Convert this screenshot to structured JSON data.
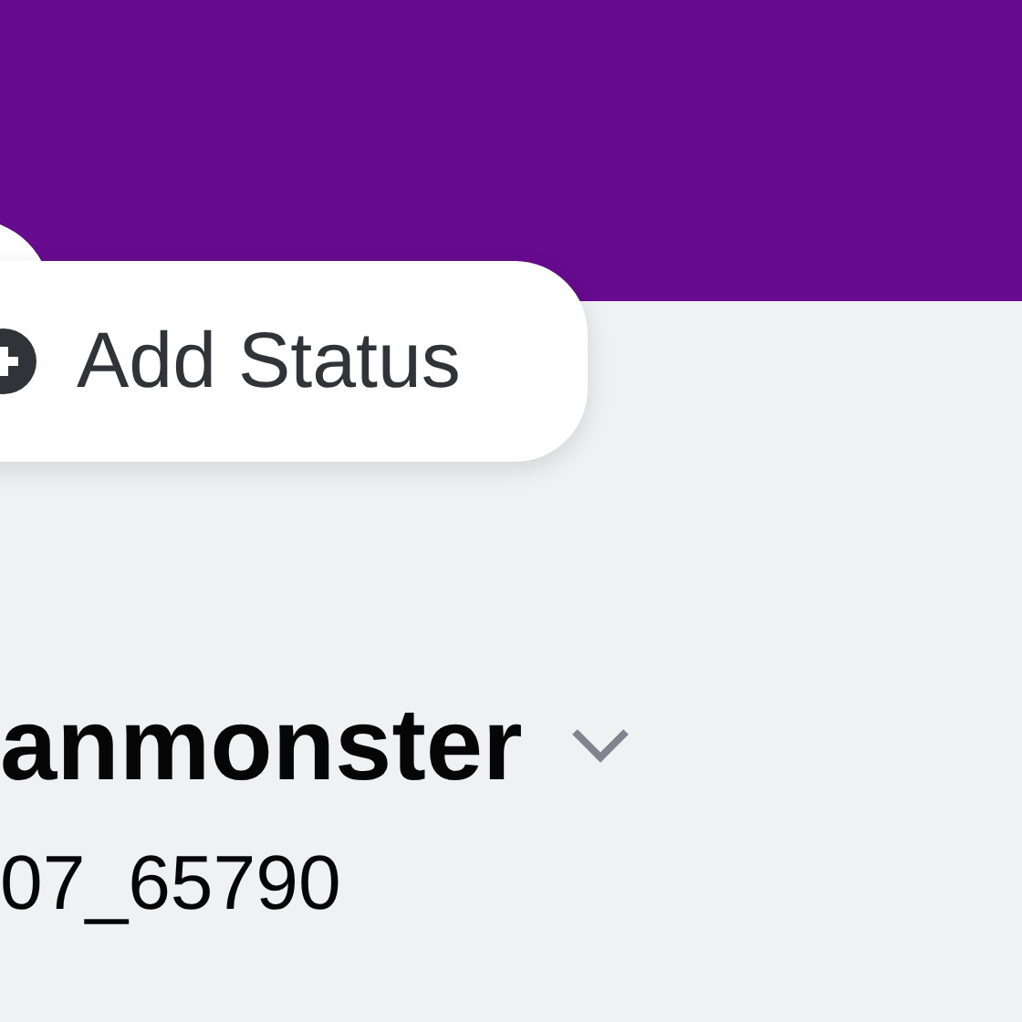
{
  "status_button": {
    "label": "Add Status"
  },
  "profile": {
    "display_name": "anmonster",
    "username": "07_65790"
  }
}
